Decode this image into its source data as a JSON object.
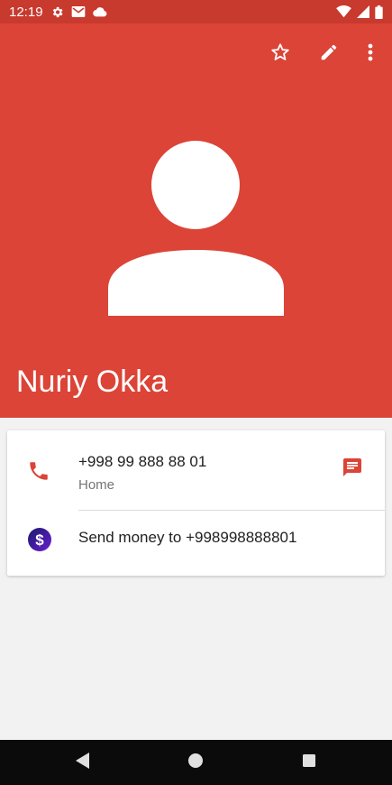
{
  "status_bar": {
    "time": "12:19",
    "left_icons": [
      "gear-icon",
      "gmail-icon",
      "cloud-icon"
    ],
    "right_icons": [
      "wifi-icon",
      "signal-icon",
      "battery-icon"
    ]
  },
  "header": {
    "background": "#db4437",
    "contact_name": "Nuriy Okka",
    "actions": [
      "star-icon",
      "edit-pencil-icon",
      "more-vert-icon"
    ]
  },
  "card": {
    "phone": {
      "number": "+998 99 888 88 01",
      "type": "Home",
      "icon": "phone-icon",
      "action_icon": "message-icon"
    },
    "money": {
      "text": "Send money to +998998888801",
      "icon": "dollar-icon"
    }
  },
  "nav_bar": {
    "buttons": [
      "back-icon",
      "home-icon",
      "recents-icon"
    ]
  },
  "colors": {
    "accent": "#db4437",
    "status_bar": "#c8392e",
    "background": "#f2f2f2"
  }
}
